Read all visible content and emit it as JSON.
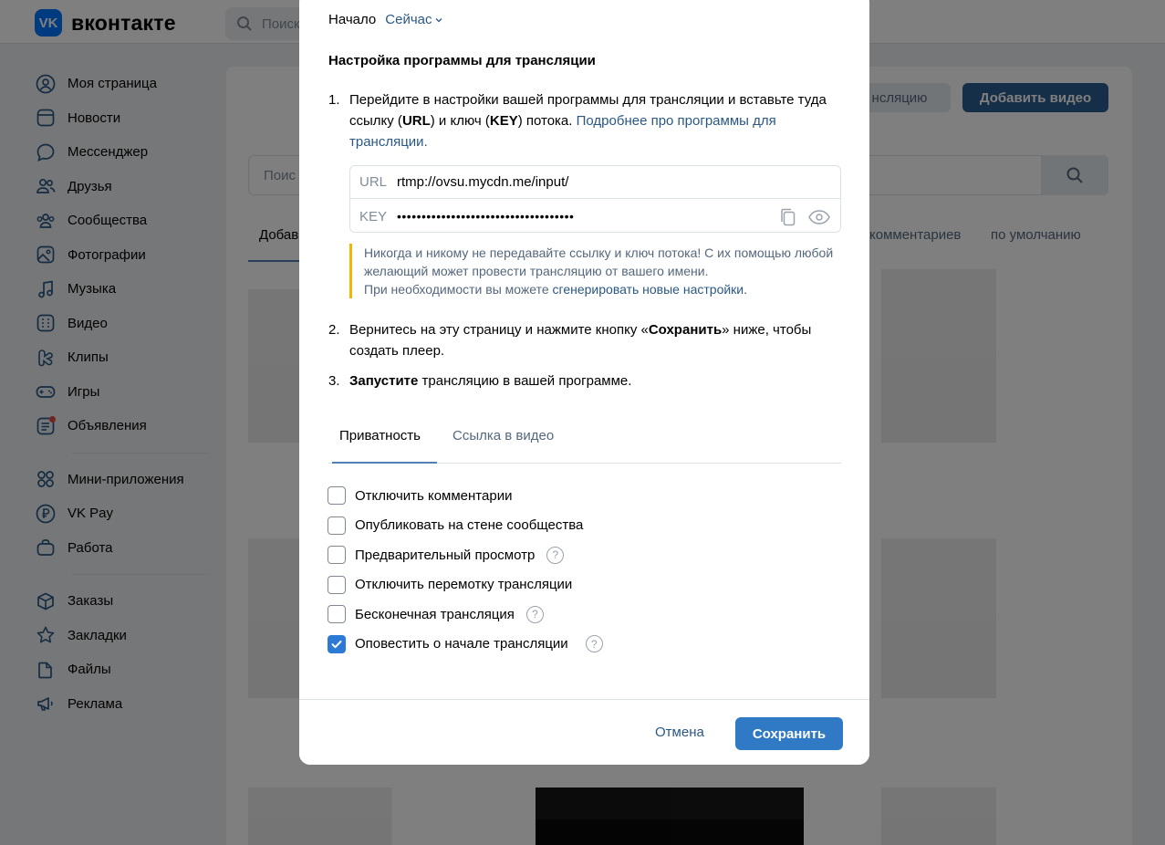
{
  "header": {
    "logo_mark": "VK",
    "logo_text": "вконтакте",
    "search_placeholder": "Поиск"
  },
  "sidebar": {
    "items": [
      {
        "label": "Моя страница",
        "icon": "user-circle-icon"
      },
      {
        "label": "Новости",
        "icon": "newspaper-icon"
      },
      {
        "label": "Мессенджер",
        "icon": "message-icon"
      },
      {
        "label": "Друзья",
        "icon": "friends-icon"
      },
      {
        "label": "Сообщества",
        "icon": "communities-icon"
      },
      {
        "label": "Фотографии",
        "icon": "photo-icon"
      },
      {
        "label": "Музыка",
        "icon": "music-icon"
      },
      {
        "label": "Видео",
        "icon": "video-icon"
      },
      {
        "label": "Клипы",
        "icon": "clips-icon"
      },
      {
        "label": "Игры",
        "icon": "gamepad-icon"
      },
      {
        "label": "Объявления",
        "icon": "ads-board-icon"
      }
    ],
    "apps": [
      {
        "label": "Мини-приложения",
        "icon": "apps-grid-icon"
      },
      {
        "label": "VK Pay",
        "icon": "ruble-icon"
      },
      {
        "label": "Работа",
        "icon": "briefcase-icon"
      }
    ],
    "extra": [
      {
        "label": "Заказы",
        "icon": "box-icon"
      },
      {
        "label": "Закладки",
        "icon": "star-icon"
      },
      {
        "label": "Файлы",
        "icon": "file-icon"
      },
      {
        "label": "Реклама",
        "icon": "megaphone-icon"
      }
    ]
  },
  "background": {
    "btn_stream_partial": "нсляцию",
    "btn_add_video": "Добавить видео",
    "search_partial": "Поис",
    "tab_partial": "Добав",
    "filter_comments": "комментариев",
    "filter_sort": "по умолчанию"
  },
  "modal": {
    "start_label": "Начало",
    "start_value": "Сейчас",
    "section_title": "Настройка программы для трансляции",
    "step1_a": "Перейдите в настройки вашей программы для трансляции и вставьте туда ссылку (",
    "step1_url": "URL",
    "step1_b": ") и ключ (",
    "step1_key": "KEY",
    "step1_c": ") потока. ",
    "step1_link": "Подробнее про программы для трансляции.",
    "url_label": "URL",
    "url_value": "rtmp://ovsu.mycdn.me/input/",
    "key_label": "KEY",
    "key_value": "••••••••••••••••••••••••••••••••••••",
    "warning_line1": "Никогда и никому не передавайте ссылку и ключ потока! С их помощью любой желающий может провести трансляцию от вашего имени.",
    "warning_line2": "При необходимости вы можете ",
    "warning_link": "сгенерировать новые настройки.",
    "step2_a": "Вернитесь на эту страницу и нажмите кнопку «",
    "step2_bold": "Сохранить",
    "step2_b": "» ниже, чтобы создать плеер.",
    "step3_bold": "Запустите",
    "step3_rest": " трансляцию в вашей программе.",
    "tab_privacy": "Приватность",
    "tab_link": "Ссылка в видео",
    "options": [
      {
        "label": "Отключить комментарии",
        "checked": false,
        "help": false
      },
      {
        "label": "Опубликовать на стене сообщества",
        "checked": false,
        "help": false
      },
      {
        "label": "Предварительный просмотр",
        "checked": false,
        "help": true
      },
      {
        "label": "Отключить перемотку трансляции",
        "checked": false,
        "help": false
      },
      {
        "label": "Бесконечная трансляция",
        "checked": false,
        "help": true
      },
      {
        "label": "Оповестить о начале трансляции",
        "checked": true,
        "help": true
      }
    ],
    "cancel_label": "Отмена",
    "save_label": "Сохранить"
  }
}
